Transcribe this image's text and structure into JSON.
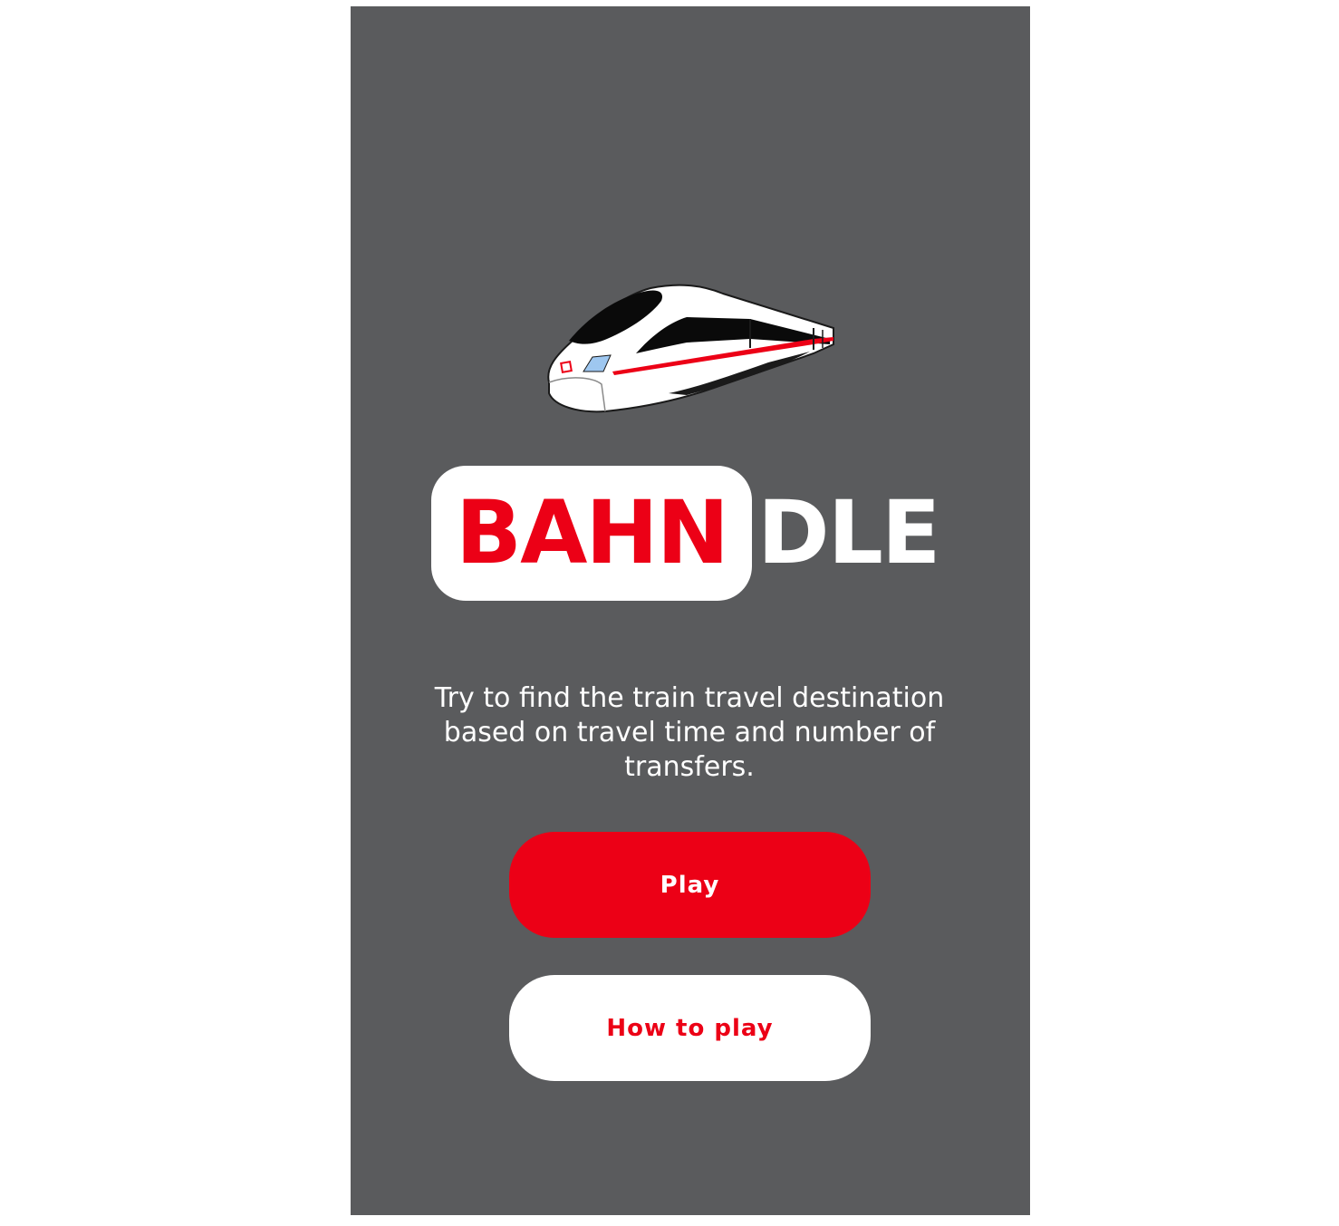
{
  "app": {
    "logo_part_1": "BAHN",
    "logo_part_2": "DLE"
  },
  "intro": {
    "description": "Try to find the train travel destination based on travel time and number of transfers."
  },
  "buttons": {
    "play_label": "Play",
    "how_to_play_label": "How to play"
  },
  "colors": {
    "background": "#5a5b5d",
    "accent_red": "#ec0016",
    "white": "#ffffff"
  },
  "icons": {
    "hero": "ice-train-icon"
  }
}
